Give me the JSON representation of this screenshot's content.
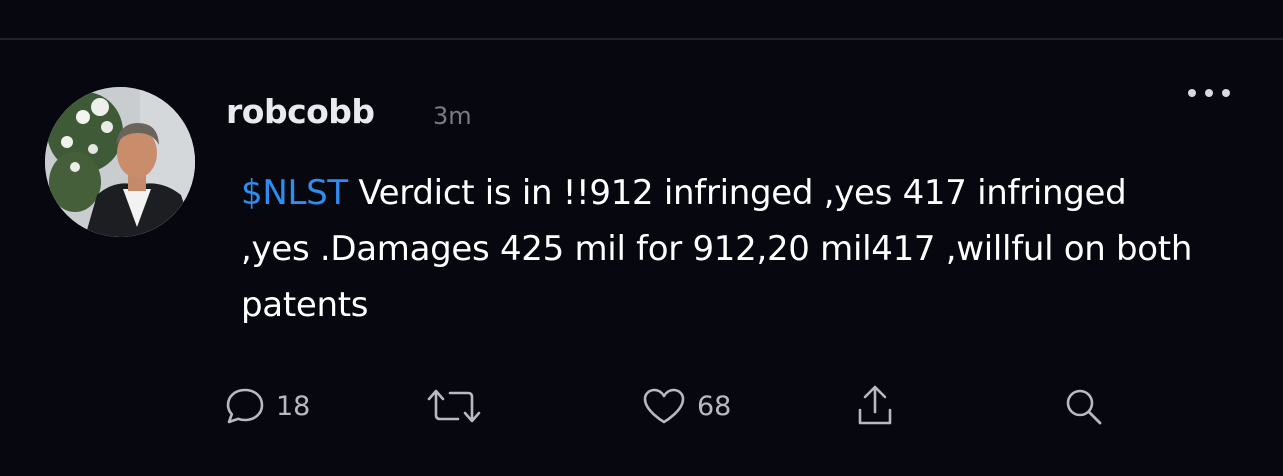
{
  "post": {
    "username": "robcobb",
    "timestamp": "3m",
    "cashtag": "$NLST",
    "body": " Verdict is in !!912 infringed ,yes 417 infringed ,yes .Damages 425 mil for 912,20 mil417 ,willful on both patents"
  },
  "actions": {
    "reply_count": "18",
    "like_count": "68"
  },
  "icons": {
    "reply": "speech-bubble-icon",
    "repost": "repost-arrows-icon",
    "like": "heart-icon",
    "share": "share-upload-icon",
    "search": "magnifier-icon",
    "more": "more-dots-icon"
  },
  "colors": {
    "background": "#07070f",
    "cashtag": "#2f8cf0",
    "muted": "#7b7b84"
  }
}
